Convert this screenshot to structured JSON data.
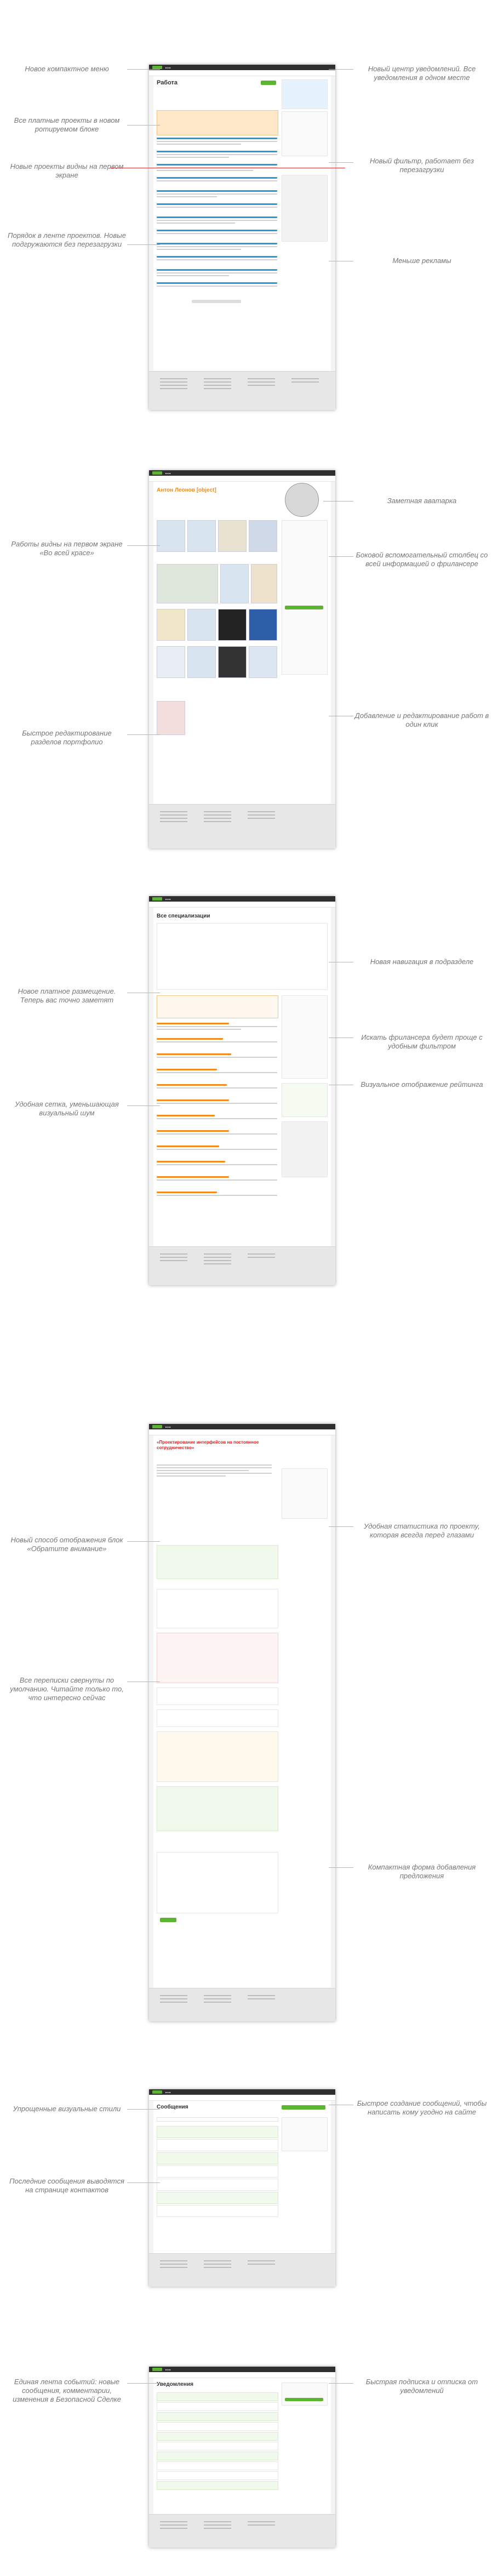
{
  "annotations": {
    "s1_left_1": "Новое компактное меню",
    "s1_left_2": "Все платные проекты в новом ротируемом блоке",
    "s1_left_3": "Новые проекты видны на первом экране",
    "s1_left_4": "Порядок в ленте проектов. Новые подгружаются без перезагрузки",
    "s1_right_1": "Новый центр уведомлений. Все уведомления в одном месте",
    "s1_right_2": "Новый фильтр, работает без перезагрузки",
    "s1_right_3": "Меньше рекламы",
    "s2_left_1": "Работы видны на первом экране «Во всей красе»",
    "s2_left_2": "Быстрое редактирование разделов портфолио",
    "s2_right_1": "Заметная аватарка",
    "s2_right_2": "Боковой вспомогательный столбец со всей информацией о фрилансере",
    "s2_right_3": "Добавление и редактирование работ в один клик",
    "s3_left_1": "Новое платное размещение. Теперь вас точно заметят",
    "s3_left_2": "Удобная сетка, уменьшающая визуальный шум",
    "s3_right_1": "Новая навигация в подразделе",
    "s3_right_2": "Искать фрилансера будет проще с удобным фильтром",
    "s3_right_3": "Визуальное отображение рейтинга",
    "s4_left_1": "Новый способ отображения блок «Обратите внимание»",
    "s4_left_2": "Все переписки свернуты по умолчанию. Читайте только то, что интересно сейчас",
    "s4_right_1": "Удобная статистика по проекту, которая всегда перед глазами",
    "s4_right_2": "Компактная форма добавления предложения",
    "s5_left_1": "Упрощенные визуальные стили",
    "s5_left_2": "Последние сообщения выводятся на странице контактов",
    "s5_right_1": "Быстрое создание сообщений, чтобы написать кому угодно на сайте",
    "s6_left_1": "Единая лента событий: новые сообщения, комментарии, изменения в Безопасной Сделке",
    "s6_right_1": "Быстрая подписка и отписка от уведомлений"
  },
  "screens": {
    "s1_title": "Работа",
    "s2_title": "Антон Леонов [object]",
    "s3_title": "Все специализации",
    "s4_title": "«Проектирование интерфейсов на постоянное сотрудничество»",
    "s5_title": "Сообщения",
    "s6_title": "Уведомления"
  },
  "colors": {
    "accent_green": "#5cb531",
    "link_blue": "#2a9ad6",
    "accent_orange": "#f08c1b",
    "topbar": "#2f2f2f"
  }
}
